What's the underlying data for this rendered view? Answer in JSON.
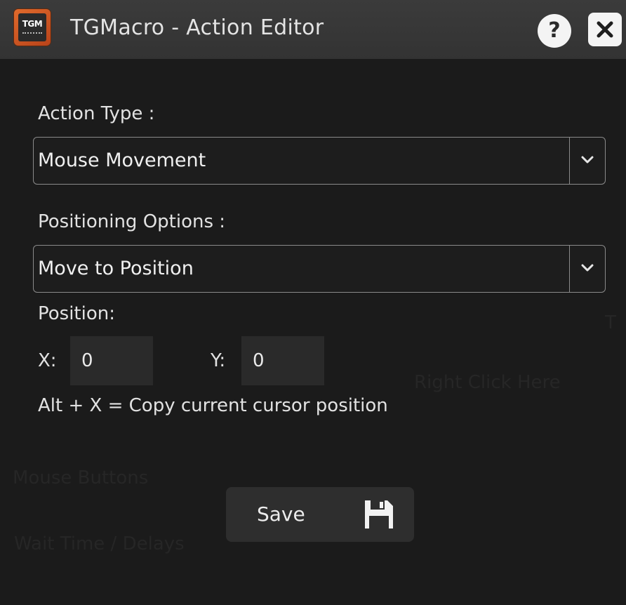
{
  "window": {
    "title": "TGMacro - Action Editor",
    "logo_text": "TGM",
    "help_label": "?"
  },
  "form": {
    "action_type_label": "Action Type :",
    "action_type_value": "Mouse Movement",
    "positioning_label": "Positioning Options :",
    "positioning_value": "Move to Position",
    "position_label": "Position:",
    "x_label": "X:",
    "x_value": "0",
    "y_label": "Y:",
    "y_value": "0",
    "hint": "Alt + X = Copy current cursor position",
    "save_label": "Save"
  },
  "background_window": {
    "text_1": "Mouse Buttons",
    "text_2": "Wait Time / Delays",
    "text_3": "Right Click Here",
    "text_4": "T"
  },
  "icons": {
    "help": "question-mark-icon",
    "close": "close-icon",
    "dropdown": "chevron-down-icon",
    "save": "floppy-disk-icon"
  },
  "colors": {
    "titlebar": "#353535",
    "background": "#1b1b1b",
    "input_bg": "#2a2a2a",
    "logo_accent": "#d35a22"
  }
}
